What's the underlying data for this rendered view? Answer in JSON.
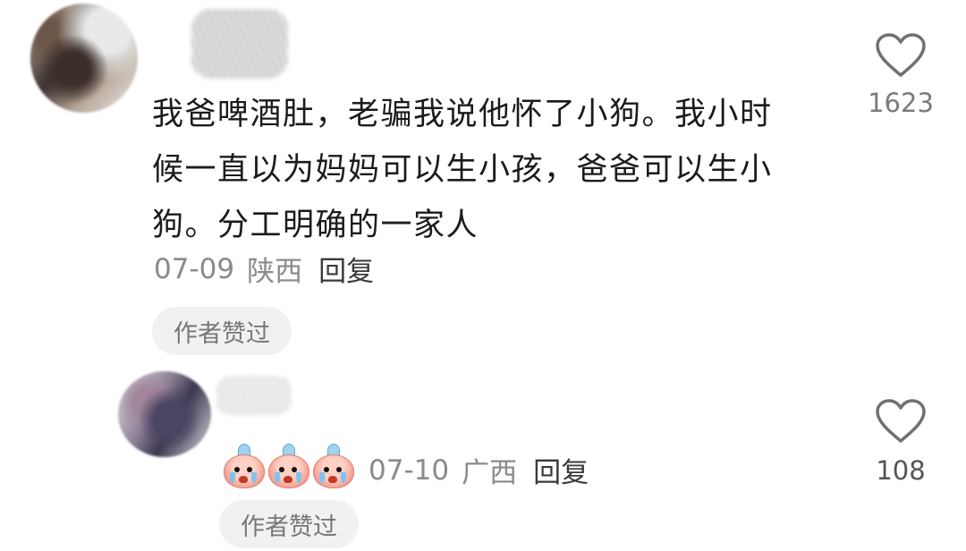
{
  "comments": [
    {
      "text": "我爸啤酒肚，老骗我说他怀了小狗。我小时候一直以为妈妈可以生小孩，爸爸可以生小狗。分工明确的一家人",
      "date": "07-09",
      "location": "陕西",
      "reply_label": "回复",
      "author_liked_badge": "作者赞过",
      "like_count": "1623",
      "like_icon": "heart-outline-icon"
    },
    {
      "emoji": [
        "crying-emoji",
        "crying-emoji",
        "crying-emoji"
      ],
      "date": "07-10",
      "location": "广西",
      "reply_label": "回复",
      "author_liked_badge": "作者赞过",
      "like_count": "108",
      "like_icon": "heart-outline-icon"
    }
  ],
  "colors": {
    "text_primary": "#1b1b1b",
    "text_secondary": "#8a8a8a",
    "badge_bg": "#f1f1f1"
  }
}
